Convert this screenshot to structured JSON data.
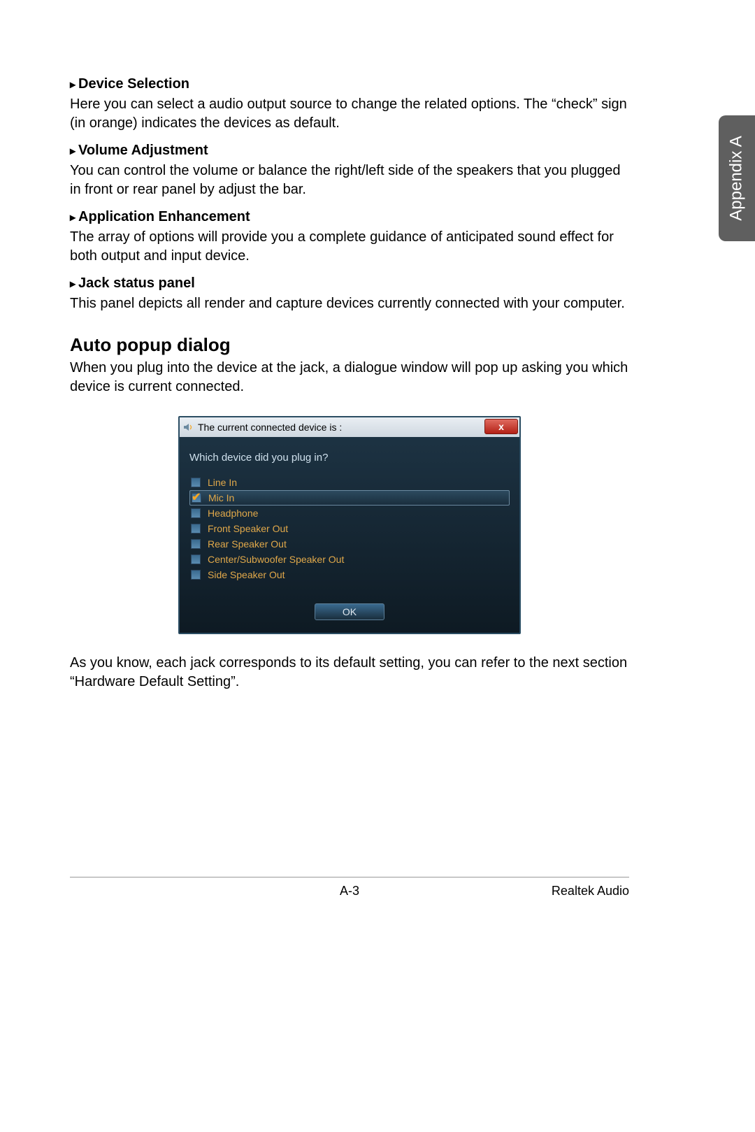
{
  "side_tab": "Appendix A",
  "sections": {
    "s0": {
      "title": "Device Selection",
      "body": "Here you can select a audio output source to change the related options. The “check” sign (in orange) indicates the devices as default."
    },
    "s1": {
      "title": "Volume Adjustment",
      "body": "You can control the volume or balance the right/left side of the speakers that you plugged in front or rear panel by adjust the bar."
    },
    "s2": {
      "title": "Application Enhancement",
      "body": "The array of options will provide you a complete guidance of anticipated sound effect for both output and input device."
    },
    "s3": {
      "title": "Jack status panel",
      "body": "This panel depicts all render and capture devices currently connected with your computer."
    }
  },
  "heading": "Auto popup dialog",
  "heading_body": "When you plug into the device at the jack, a dialogue window will pop up asking you which device is current connected.",
  "dialog": {
    "title": "The current connected device is :",
    "prompt": "Which device did you plug in?",
    "items": {
      "i0": {
        "label": "Line In",
        "checked": false,
        "selected": false
      },
      "i1": {
        "label": "Mic In",
        "checked": true,
        "selected": true
      },
      "i2": {
        "label": "Headphone",
        "checked": false,
        "selected": false
      },
      "i3": {
        "label": "Front Speaker Out",
        "checked": false,
        "selected": false
      },
      "i4": {
        "label": "Rear Speaker Out",
        "checked": false,
        "selected": false
      },
      "i5": {
        "label": "Center/Subwoofer Speaker Out",
        "checked": false,
        "selected": false
      },
      "i6": {
        "label": "Side Speaker Out",
        "checked": false,
        "selected": false
      }
    },
    "ok": "OK",
    "close": "x"
  },
  "after_dialog": "As you know, each jack corresponds to its default setting, you can refer to the next section “Hardware Default Setting”.",
  "footer": {
    "page": "A-3",
    "product": "Realtek Audio"
  }
}
